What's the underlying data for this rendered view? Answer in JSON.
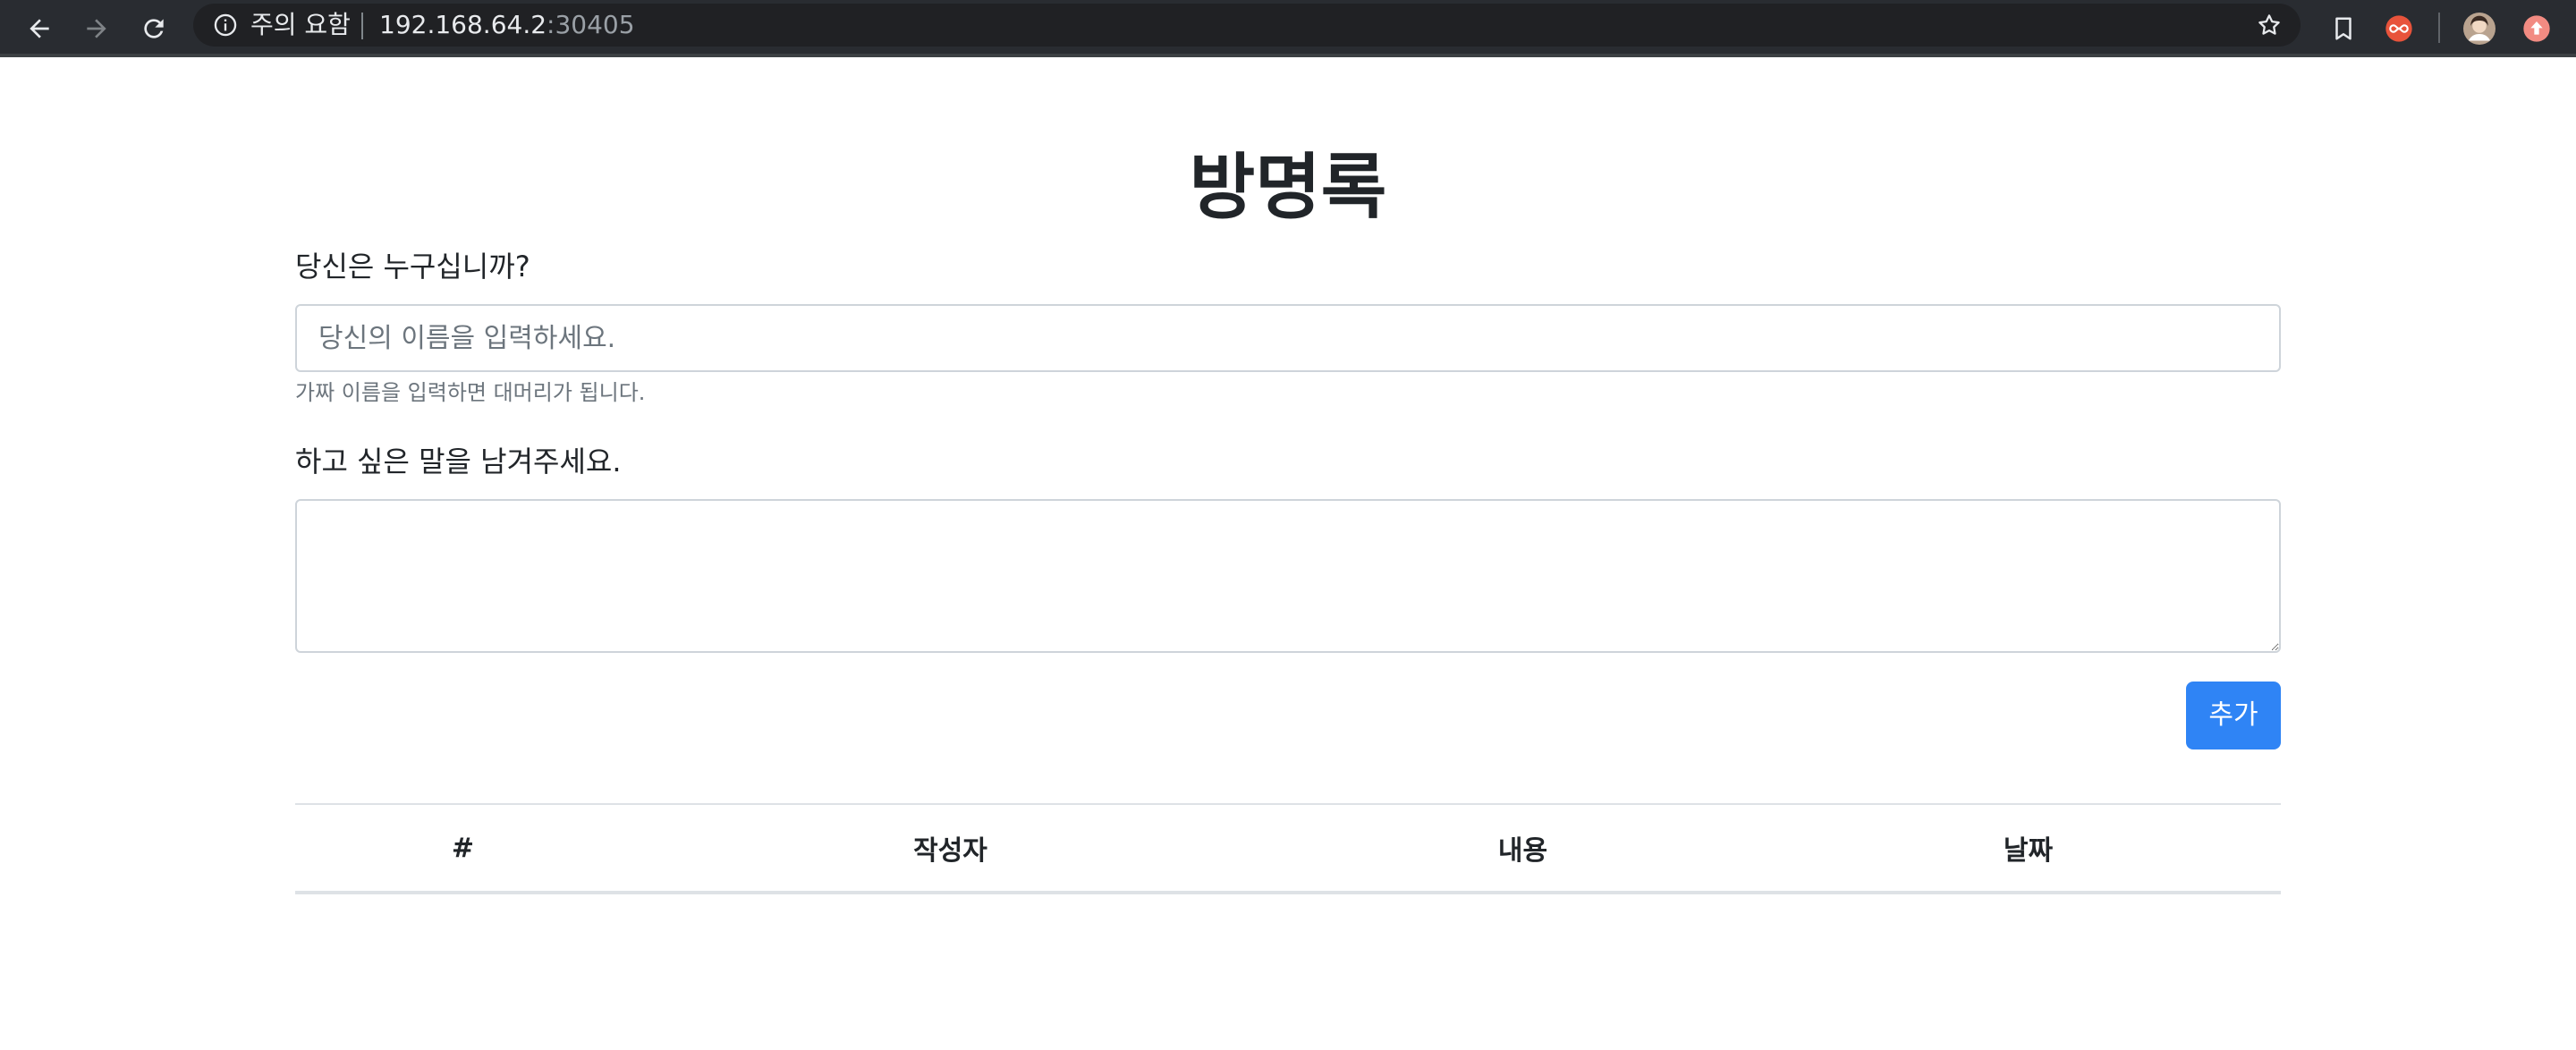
{
  "browser": {
    "security_label": "주의 요함",
    "url_host": "192.168.64.2",
    "url_port": ":30405",
    "icons": {
      "back": "back-arrow-icon",
      "forward": "forward-arrow-icon",
      "reload": "reload-icon",
      "info": "info-icon",
      "star": "star-icon",
      "bookmark": "bookmark-icon",
      "extension": "infinity-extension-icon",
      "profile": "profile-avatar-icon",
      "update": "update-arrow-icon"
    },
    "colors": {
      "toolbar_bg": "#292c31",
      "omnibox_bg": "#202124",
      "extension_accent": "#e8533b",
      "update_accent": "#f28b82"
    }
  },
  "page": {
    "title": "방명록",
    "name_label": "당신은 누구십니까?",
    "name_placeholder": "당신의 이름을 입력하세요.",
    "name_value": "",
    "name_help": "가짜 이름을 입력하면 대머리가 됩니다.",
    "message_label": "하고 싶은 말을 남겨주세요.",
    "message_value": "",
    "add_button": "추가",
    "accent_color": "#2f84f5",
    "table": {
      "headers": [
        "#",
        "작성자",
        "내용",
        "날짜"
      ],
      "rows": []
    }
  }
}
